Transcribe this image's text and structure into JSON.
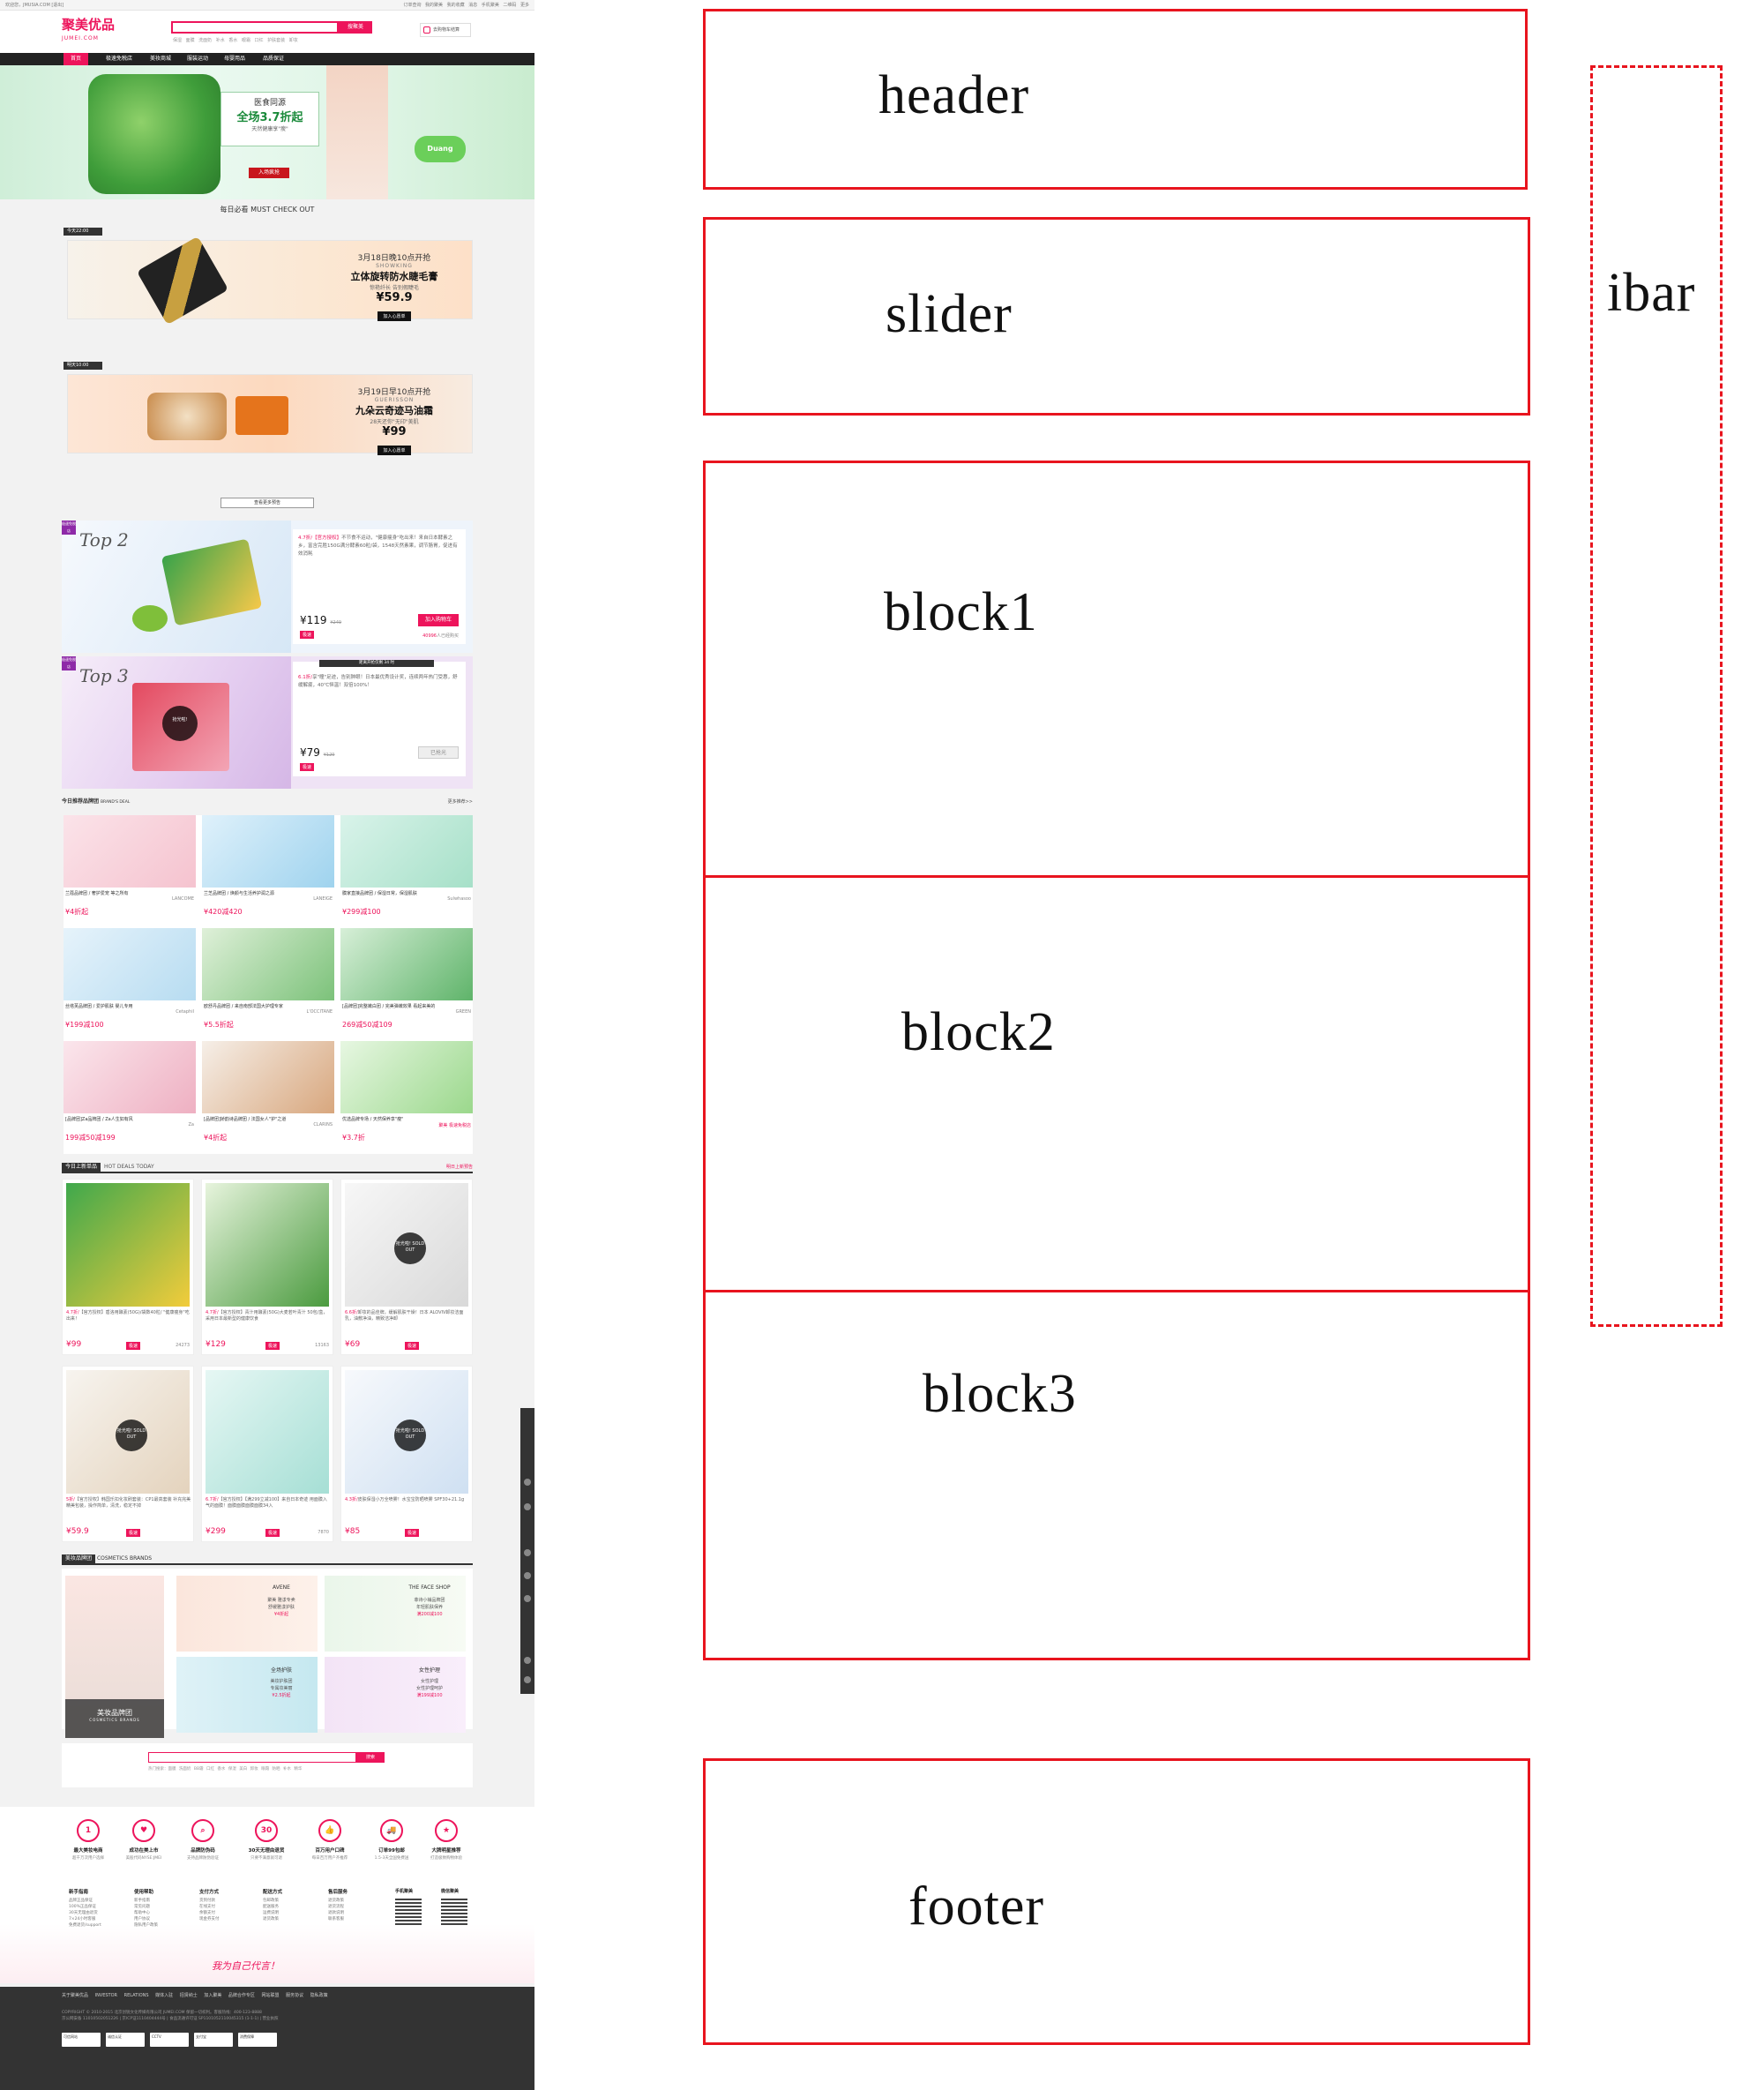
{
  "topbar": {
    "welcome": "欢迎您，JMUSIA.COM [退出]",
    "links": "订单查询  我的聚美  我的收藏  消息  手机聚美  二维码  更多"
  },
  "header": {
    "logo": "聚美优品",
    "logo_sub": "JUMEI.COM",
    "search_button": "搜聚美",
    "hot_words": "保湿  面膜  洗面奶  补水  香水  眼霜  口红  护肤套装  卸妆",
    "cart": "去购物车结算"
  },
  "nav": [
    "首页",
    "极速免税店",
    "美妆商城",
    "服装运动",
    "母婴用品",
    "品质保证"
  ],
  "banner": {
    "line1": "医食同源",
    "line2": "全场3.7折起",
    "line3": "天然健康享\"瘦\"",
    "btn": "入场疯抢",
    "duang": "Duang"
  },
  "daily": {
    "title": "每日必看  MUST CHECK OUT"
  },
  "deals": [
    {
      "tag": "今天22:00",
      "time": "3月18日晚10点开抢",
      "brand": "SHOWKING",
      "name": "立体旋转防水睫毛膏",
      "slogan": "惊艳纤长 告别假睫毛",
      "price": "¥59.9",
      "btn": "加入心愿单"
    },
    {
      "tag": "明天10:00",
      "time": "3月19日早10点开抢",
      "brand": "GUERISSON",
      "name": "九朵云奇迹马油霜",
      "slogan": "28天还你\"无印\"美肌",
      "price": "¥99",
      "btn": "加入心愿单"
    }
  ],
  "more_button": "查看更多预告",
  "tops": [
    {
      "rank": "Top 2",
      "badge": "极速免税店",
      "desc_em": "4.7折/【官方授权】",
      "desc": "不节食不运动，\"健康瘦身\"吃出来！来自日本酵素之乡，富含完胜150G满分酵素60粒/袋，1548天然素果，调节肠胃，促进有效消耗",
      "price": "¥119",
      "old": "¥249",
      "btn": "加入购物车",
      "ex": "极速",
      "count": "40996",
      "count_suffix": "人已经购买"
    },
    {
      "rank": "Top 3",
      "badge": "极速免税店",
      "desc_em": "6.1折/",
      "desc": "享\"瞳\"足迹，告别肿眼！日本最优秀设计奖，连续两年热门受惠，舒缓解疲，40℃恒温！双倍100%！",
      "price": "¥79",
      "old": "¥129",
      "btn": "已抢光",
      "ex": "极速",
      "count": "",
      "count_suffix": "",
      "timer": "距离开抢仅剩 34 时"
    }
  ],
  "brand_deal": {
    "title": "今日推荐品牌团",
    "sub": "BRAND'S DEAL",
    "more": "更多推荐>>"
  },
  "brands": [
    {
      "name": "兰蔻品牌团 / 奢护爱宠 等之所有",
      "price": "¥4折起",
      "logo": "LANCOME"
    },
    {
      "name": "兰芝品牌团 / 焕颜与生活养护润之源",
      "price": "¥420减420",
      "logo": "LANEIGE"
    },
    {
      "name": "膜家直接品牌团 / 保湿日常，保湿肌肤",
      "price": "¥299减100",
      "logo": "Sulwhasoo"
    },
    {
      "name": "丝塔芙品牌团 / 爱护肌肤 婴儿专用",
      "price": "¥199减100",
      "logo": "Cetaphil"
    },
    {
      "name": "欧舒丹品牌团 / 来自南部法国大护理专家",
      "price": "¥5.5折起",
      "logo": "L'OCCITANE"
    },
    {
      "name": "[品牌团]完整嫩白团 / 完美弹嫩效果 看起来美的",
      "price": "269减50减109",
      "logo": "GREEN"
    },
    {
      "name": "[品牌团]Za品牌团 / Za人生如有风",
      "price": "199减50减199",
      "logo": "Za"
    },
    {
      "name": "[品牌团]娇韵诗品牌团 / 法国女人\"护\"之道",
      "price": "¥4折起",
      "logo": "CLARINS"
    },
    {
      "name": "优选品牌专场 / 天然保养享\"瘦\"",
      "price": "¥3.7折",
      "logo": "聚美 极速免税店"
    }
  ],
  "hot": {
    "title": "今日上新单品",
    "sub": "HOT DEALS TODAY",
    "more": "明日上新预告"
  },
  "hot_items": [
    {
      "desc_em": "4.7折/",
      "desc": "【官方授权】盾洛用酵素(50G)/袋数40粒/ \"健康瘦身\"吃出来！",
      "price": "¥99",
      "old": "¥149",
      "ex": "极速",
      "count": "24273",
      "sold": ""
    },
    {
      "desc_em": "4.7折/",
      "desc": "【官方授权】青汁用酵素(50G)大麦若叶青汁 50包/盒，采用日本最新型的健康饮食",
      "price": "¥129",
      "old": "¥289",
      "ex": "极速",
      "count": "13163",
      "sold": ""
    },
    {
      "desc_em": "6.6折/",
      "desc": "卸妆的品佳牌，缓解肌肤干燥！日本 ALOVIV卸妆洁面乳，油敷净油，精致洁净卸",
      "price": "¥69",
      "old": "¥99",
      "ex": "极速",
      "count": "",
      "sold": "抢光啦! SOLD OUT"
    },
    {
      "desc_em": "5折/",
      "desc": "【官方授权】韩国乐扣化妆刷套装：CP1最高套装 补充完美 精美包装，操作简单，清洗，稳定不掉",
      "price": "¥59.9",
      "old": "¥118",
      "ex": "极速",
      "count": "",
      "sold": "抢光啦! SOLD OUT"
    },
    {
      "desc_em": "6.7折/",
      "desc": "【官方授权】【满299立减100】来自日本奇迹 用面膜入气的面膜！面膜面膜面膜面膜34入",
      "price": "¥299",
      "old": "¥448",
      "ex": "极速",
      "count": "7870",
      "sold": ""
    },
    {
      "desc_em": "4.3折/",
      "desc": "皮肤保湿小万全喷雾！水宝宝防晒喷雾 SPF30+21.1g",
      "price": "¥85",
      "old": "¥199",
      "ex": "极速",
      "count": "",
      "sold": "抢光啦! SOLD OUT"
    }
  ],
  "cosmetics": {
    "title": "美妆品牌团",
    "sub": "COSMETICS BRANDS",
    "label": "美妆品牌团",
    "label_sub": "COSMETICS BRANDS"
  },
  "cos_cells": [
    {
      "brand": "AVENE",
      "name": "聚美 雅漾专卖",
      "desc": "舒缓雅漾护肤",
      "price": "¥4折起"
    },
    {
      "brand": "THE FACE SHOP",
      "name": "菲诗小铺品牌团",
      "desc": "年轻肌肤保养",
      "price": "满200减100"
    },
    {
      "brand": "全场护肤",
      "name": "美妆护肤团",
      "desc": "专属妆美丽",
      "price": "¥2.5折起"
    },
    {
      "brand": "女性护理",
      "name": "女性护理",
      "desc": "女性护理呵护",
      "price": "满199减100"
    }
  ],
  "bottom_search": {
    "button": "搜索",
    "hot": "热门搜索：面膜  洗面奶  BB霜  口红  香水  保湿  美白  卸妆  眼霜  防晒  补水  精华"
  },
  "services": [
    {
      "icon": "1",
      "title": "最大美妆电商",
      "sub": "超千万次用户选择"
    },
    {
      "icon": "♥",
      "title": "成功在美上市",
      "sub": "美股代码NYSE:JMEI"
    },
    {
      "icon": "⌕",
      "title": "品牌防伪码",
      "sub": "支持品牌防伪验证"
    },
    {
      "icon": "30",
      "title": "30天无理由退货",
      "sub": "只要不满意就可退"
    },
    {
      "icon": "👍",
      "title": "百万用户口碑",
      "sub": "每日百万用户齐推荐"
    },
    {
      "icon": "🚚",
      "title": "订单99包邮",
      "sub": "1.5-3天全国免费送"
    },
    {
      "icon": "★",
      "title": "大牌明星推荐",
      "sub": "打造极致购物体验"
    }
  ],
  "link_cols": [
    {
      "head": "新手指南",
      "items": [
        "品牌正品保证",
        "100%正品保证",
        "30天无理由退货",
        "7×24小时客服",
        "免费退货/support"
      ]
    },
    {
      "head": "使用帮助",
      "items": [
        "新手指南",
        "常见问题",
        "帮助中心",
        "用户协议",
        "隐私用户政策"
      ]
    },
    {
      "head": "支付方式",
      "items": [
        "货到付款",
        "在线支付",
        "余额支付",
        "现金券支付"
      ]
    },
    {
      "head": "配送方式",
      "items": [
        "包邮政策",
        "配送服务",
        "运费说明",
        "退货政策"
      ]
    },
    {
      "head": "售后服务",
      "items": [
        "退货政策",
        "退货流程",
        "退款说明",
        "联系客服"
      ]
    }
  ],
  "qr": [
    {
      "label": "手机聚美"
    },
    {
      "label": "微信聚美"
    }
  ],
  "slogan": "我为自己代言！",
  "footer": {
    "nav": "关于聚美优品  INVESTOR RELATIONS  媒体入驻  招贤纳士  加入聚美  品牌合作专区  网站联盟  服务协议  隐私政策",
    "copy": "COPYRIGHT © 2010-2015 北京创锐文化传媒有限公司 JUMEI.COM 保留一切权利。客服热线：400-123-8888",
    "icp": "京公网安备 11010502051226 | 京ICP证1110404444号 | 食品流通许可证 SP1101052110045315 (1-1-1) | 营业执照",
    "badges": [
      "可信网站",
      "诚信认证",
      "CCTV",
      "支付宝",
      "消费保障"
    ]
  },
  "diagram": {
    "header": "header",
    "slider": "slider",
    "block1": "block1",
    "block2": "block2",
    "block3": "block3",
    "footer": "footer",
    "ibar": "ibar"
  }
}
